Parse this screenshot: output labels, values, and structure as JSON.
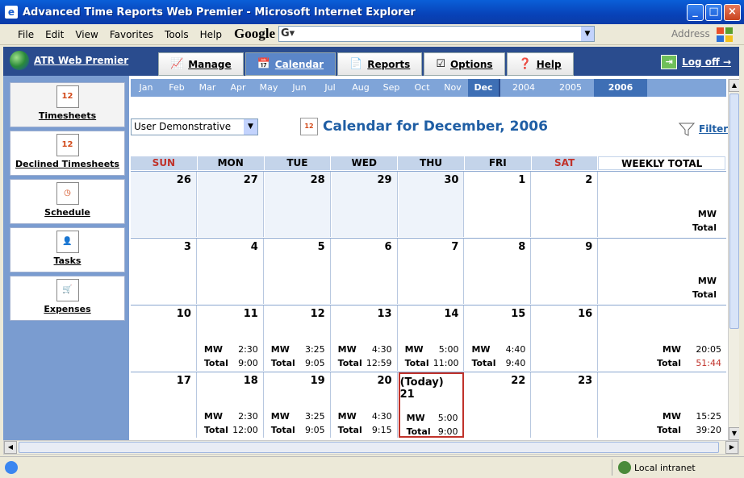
{
  "window": {
    "title": "Advanced Time Reports Web Premier - Microsoft Internet Explorer"
  },
  "menu": [
    "File",
    "Edit",
    "View",
    "Favorites",
    "Tools",
    "Help"
  ],
  "toolbar": {
    "google_label": "Google",
    "search_prefix": "G▾",
    "address_label": "Address"
  },
  "app": {
    "brand": "ATR Web Premier",
    "tabs": [
      {
        "label": "Manage",
        "icon": "chart-icon"
      },
      {
        "label": "Calendar",
        "icon": "calendar-icon"
      },
      {
        "label": "Reports",
        "icon": "document-icon"
      },
      {
        "label": "Options",
        "icon": "checklist-icon"
      },
      {
        "label": "Help",
        "icon": "help-icon"
      }
    ],
    "logoff": "Log off →"
  },
  "sidebar": [
    {
      "label": "Timesheets",
      "icon_text": "12"
    },
    {
      "label": "Declined Timesheets",
      "icon_text": "12"
    },
    {
      "label": "Schedule",
      "icon_text": "◷"
    },
    {
      "label": "Tasks",
      "icon_text": "👤"
    },
    {
      "label": "Expenses",
      "icon_text": "🛒"
    }
  ],
  "months": [
    "Jan",
    "Feb",
    "Mar",
    "Apr",
    "May",
    "Jun",
    "Jul",
    "Aug",
    "Sep",
    "Oct",
    "Nov",
    "Dec"
  ],
  "selected_month": "Dec",
  "years": [
    "2004",
    "2005",
    "2006"
  ],
  "selected_year": "2006",
  "user_select": "User Demonstrative",
  "calendar_title": "Calendar for December, 2006",
  "calendar_icon_text": "12",
  "filter_label": "Filter",
  "weekday_headers": [
    "SUN",
    "MON",
    "TUE",
    "WED",
    "THU",
    "FRI",
    "SAT",
    "WEEKLY TOTAL"
  ],
  "weeks": [
    {
      "days": [
        {
          "n": "26",
          "prev": true
        },
        {
          "n": "27",
          "prev": true
        },
        {
          "n": "28",
          "prev": true
        },
        {
          "n": "29",
          "prev": true
        },
        {
          "n": "30",
          "prev": true
        },
        {
          "n": "1"
        },
        {
          "n": "2"
        }
      ],
      "total": {
        "l1": "MW",
        "l2": "Total"
      }
    },
    {
      "days": [
        {
          "n": "3"
        },
        {
          "n": "4"
        },
        {
          "n": "5"
        },
        {
          "n": "6"
        },
        {
          "n": "7"
        },
        {
          "n": "8"
        },
        {
          "n": "9"
        }
      ],
      "total": {
        "l1": "MW",
        "l2": "Total"
      }
    },
    {
      "days": [
        {
          "n": "10"
        },
        {
          "n": "11",
          "l1": "MW",
          "v1": "2:30",
          "l2": "Total",
          "v2": "9:00"
        },
        {
          "n": "12",
          "l1": "MW",
          "v1": "3:25",
          "l2": "Total",
          "v2": "9:05"
        },
        {
          "n": "13",
          "l1": "MW",
          "v1": "4:30",
          "l2": "Total",
          "v2": "12:59"
        },
        {
          "n": "14",
          "l1": "MW",
          "v1": "5:00",
          "l2": "Total",
          "v2": "11:00"
        },
        {
          "n": "15",
          "l1": "MW",
          "v1": "4:40",
          "l2": "Total",
          "v2": "9:40"
        },
        {
          "n": "16"
        }
      ],
      "total": {
        "l1": "MW",
        "v1": "20:05",
        "l2": "Total",
        "v2": "51:44",
        "v2_color": "#c0322a"
      }
    },
    {
      "days": [
        {
          "n": "17"
        },
        {
          "n": "18",
          "l1": "MW",
          "v1": "2:30",
          "l2": "Total",
          "v2": "12:00"
        },
        {
          "n": "19",
          "l1": "MW",
          "v1": "3:25",
          "l2": "Total",
          "v2": "9:05"
        },
        {
          "n": "20",
          "l1": "MW",
          "v1": "4:30",
          "l2": "Total",
          "v2": "9:15"
        },
        {
          "n": "(Today) 21",
          "today": true,
          "l1": "MW",
          "v1": "5:00",
          "l2": "Total",
          "v2": "9:00"
        },
        {
          "n": "22"
        },
        {
          "n": "23"
        }
      ],
      "total": {
        "l1": "MW",
        "v1": "15:25",
        "l2": "Total",
        "v2": "39:20"
      }
    }
  ],
  "status": {
    "zone": "Local intranet"
  },
  "colors": {
    "accent": "#1f5ea4",
    "weekend": "#c0322a",
    "today_border": "#c0322a"
  }
}
